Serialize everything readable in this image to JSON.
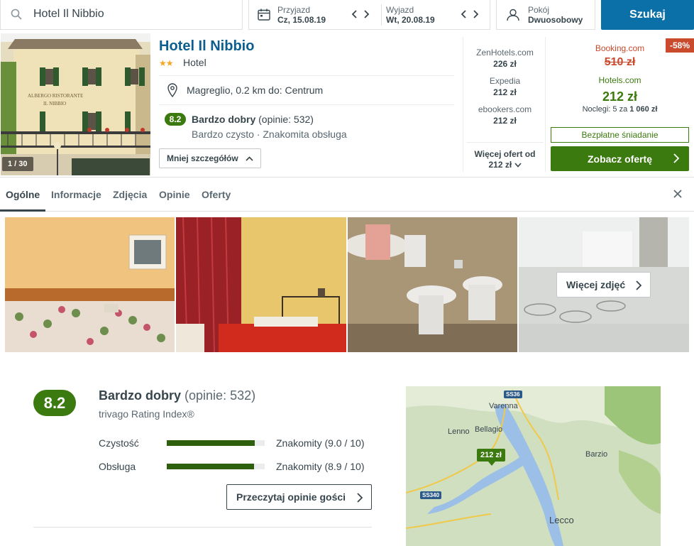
{
  "search": {
    "query": "Hotel Il Nibbio"
  },
  "dates": {
    "checkin_label": "Przyjazd",
    "checkin_value": "Cz, 15.08.19",
    "checkout_label": "Wyjazd",
    "checkout_value": "Wt, 20.08.19"
  },
  "room": {
    "label": "Pokój",
    "value": "Dwuosobowy"
  },
  "search_button": "Szukaj",
  "hotel": {
    "name": "Hotel Il Nibbio",
    "stars": 2,
    "star_glyphs": "★★",
    "type": "Hotel",
    "location": "Magreglio, 0.2 km do: Centrum",
    "score": "8.2",
    "rating_word": "Bardzo dobry",
    "review_count": "(opinie: 532)",
    "highlights": "Bardzo czysto · Znakomita obsługa",
    "photo_counter": "1 / 30",
    "less_details": "Mniej szczegółów"
  },
  "partners": [
    {
      "name": "ZenHotels.com",
      "price": "226 zł"
    },
    {
      "name": "Expedia",
      "price": "212 zł"
    },
    {
      "name": "ebookers.com",
      "price": "212 zł"
    }
  ],
  "more_offers": {
    "line1": "Więcej ofert od",
    "line2": "212 zł"
  },
  "deal": {
    "discount": "-58%",
    "strike_provider": "Booking.com",
    "strike_price": "510 zł",
    "provider": "Hotels.com",
    "price": "212 zł",
    "nights_prefix": "Noclegi: 5 za ",
    "nights_total": "1 060 zł",
    "breakfast": "Bezpłatne śniadanie",
    "cta": "Zobacz ofertę"
  },
  "tabs": [
    "Ogólne",
    "Informacje",
    "Zdjęcia",
    "Opinie",
    "Oferty"
  ],
  "gallery": {
    "more_photos": "Więcej zdjęć"
  },
  "rating_section": {
    "score": "8.2",
    "word": "Bardzo dobry",
    "count": "(opinie: 532)",
    "index_label": "trivago Rating Index®",
    "criteria": [
      {
        "name": "Czystość",
        "value_text": "Znakomity (9.0 / 10)",
        "value": 9.0
      },
      {
        "name": "Obsługa",
        "value_text": "Znakomity (8.9 / 10)",
        "value": 8.9
      }
    ],
    "read_reviews": "Przeczytaj opinie gości"
  },
  "map": {
    "pin_price": "212 zł",
    "places": [
      "Varenna",
      "Lenno",
      "Bellagio",
      "Barzio",
      "Lecco"
    ],
    "roads": [
      "SS36",
      "SS340"
    ]
  },
  "colors": {
    "brand_blue": "#0b70a8",
    "deal_green": "#3b7a0e",
    "discount_red": "#c94a2d"
  }
}
